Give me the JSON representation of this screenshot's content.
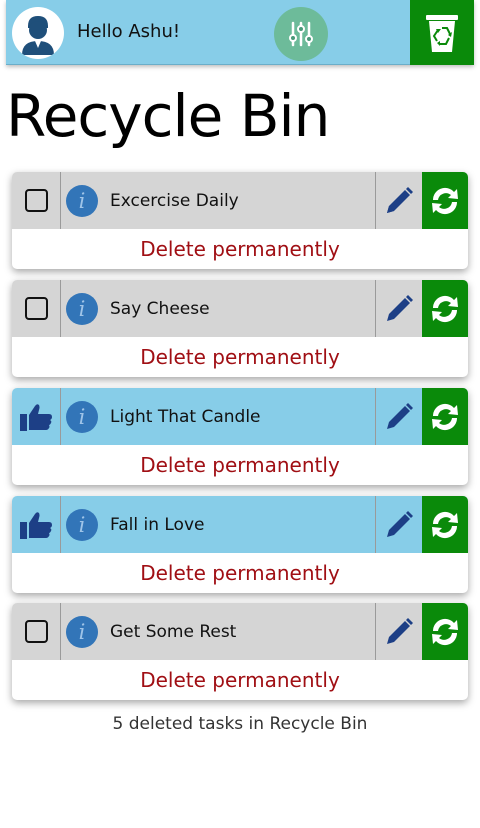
{
  "header": {
    "greeting": "Hello Ashu!",
    "avatar_icon": "user-avatar-icon",
    "filter_icon": "sliders-icon",
    "bin_icon": "recycle-bin-icon",
    "header_color": "#87cde8",
    "bin_color": "#0a8a0a"
  },
  "page": {
    "title": "Recycle Bin"
  },
  "tasks": [
    {
      "title": "Excercise Daily",
      "liked": false,
      "action": "Delete permanently"
    },
    {
      "title": "Say Cheese",
      "liked": false,
      "action": "Delete permanently"
    },
    {
      "title": "Light That Candle",
      "liked": true,
      "action": "Delete permanently"
    },
    {
      "title": "Fall in Love",
      "liked": true,
      "action": "Delete permanently"
    },
    {
      "title": "Get Some Rest",
      "liked": false,
      "action": "Delete permanently"
    }
  ],
  "footer": {
    "count_text": "5 deleted tasks in Recycle Bin"
  },
  "colors": {
    "card_default": "#d5d5d5",
    "card_liked": "#87cde8",
    "delete_text": "#a00f14",
    "restore_bg": "#0a8a0a",
    "info_blue": "#3275b8",
    "edit_blue": "#1d3f86"
  }
}
